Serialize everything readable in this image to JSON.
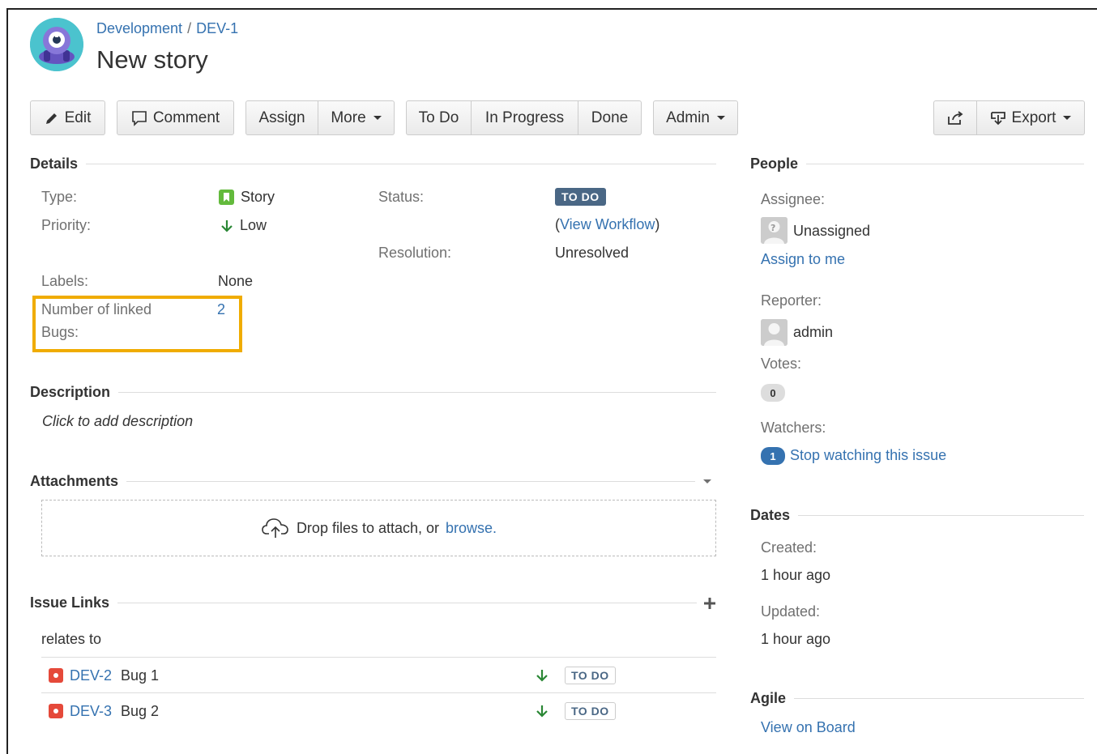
{
  "breadcrumb": {
    "project": "Development",
    "separator": "/",
    "issue_key": "DEV-1"
  },
  "issue": {
    "title": "New story"
  },
  "toolbar": {
    "edit": "Edit",
    "comment": "Comment",
    "assign": "Assign",
    "more": "More",
    "todo": "To Do",
    "in_progress": "In Progress",
    "done": "Done",
    "admin": "Admin",
    "export": "Export"
  },
  "details": {
    "header": "Details",
    "type_label": "Type:",
    "type_value": "Story",
    "priority_label": "Priority:",
    "priority_value": "Low",
    "status_label": "Status:",
    "status_value": "TO DO",
    "view_workflow_open": "(",
    "view_workflow": "View Workflow",
    "view_workflow_close": ")",
    "resolution_label": "Resolution:",
    "resolution_value": "Unresolved",
    "labels_label": "Labels:",
    "labels_value": "None",
    "linked_bugs_label_1": "Number of linked",
    "linked_bugs_label_2": "Bugs:",
    "linked_bugs_value": "2"
  },
  "description": {
    "header": "Description",
    "placeholder": "Click to add description"
  },
  "attachments": {
    "header": "Attachments",
    "drop_text": "Drop files to attach, or",
    "browse": "browse."
  },
  "issue_links": {
    "header": "Issue Links",
    "relation": "relates to",
    "items": [
      {
        "key": "DEV-2",
        "summary": "Bug 1",
        "status": "TO DO"
      },
      {
        "key": "DEV-3",
        "summary": "Bug 2",
        "status": "TO DO"
      }
    ]
  },
  "people": {
    "header": "People",
    "assignee_label": "Assignee:",
    "assignee_value": "Unassigned",
    "assign_to_me": "Assign to me",
    "reporter_label": "Reporter:",
    "reporter_value": "admin",
    "votes_label": "Votes:",
    "votes_count": "0",
    "watchers_label": "Watchers:",
    "watchers_count": "1",
    "stop_watching": "Stop watching this issue"
  },
  "dates": {
    "header": "Dates",
    "created_label": "Created:",
    "created_value": "1 hour ago",
    "updated_label": "Updated:",
    "updated_value": "1 hour ago"
  },
  "agile": {
    "header": "Agile",
    "view_on_board": "View on Board"
  },
  "colors": {
    "link": "#3572b0",
    "status_lozenge": "#4a6785",
    "story_icon": "#63ba3c",
    "bug_icon": "#e5493a",
    "priority_low": "#2a8735",
    "highlight": "#f0ac00"
  }
}
